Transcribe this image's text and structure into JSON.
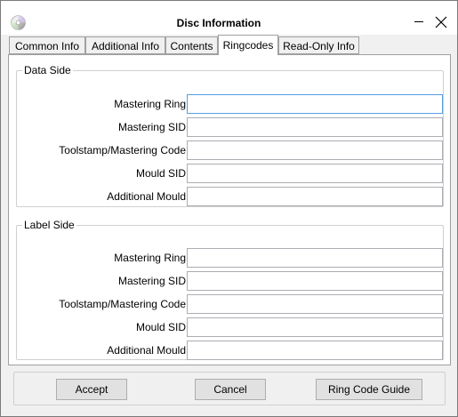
{
  "window": {
    "title": "Disc Information"
  },
  "tabs": [
    {
      "label": "Common Info"
    },
    {
      "label": "Additional Info"
    },
    {
      "label": "Contents"
    },
    {
      "label": "Ringcodes"
    },
    {
      "label": "Read-Only Info"
    }
  ],
  "active_tab": "Ringcodes",
  "data_side": {
    "legend": "Data Side",
    "fields": [
      {
        "label": "Mastering Ring",
        "value": ""
      },
      {
        "label": "Mastering SID",
        "value": ""
      },
      {
        "label": "Toolstamp/Mastering Code",
        "value": ""
      },
      {
        "label": "Mould SID",
        "value": ""
      },
      {
        "label": "Additional Mould",
        "value": ""
      }
    ]
  },
  "label_side": {
    "legend": "Label Side",
    "fields": [
      {
        "label": "Mastering Ring",
        "value": ""
      },
      {
        "label": "Mastering SID",
        "value": ""
      },
      {
        "label": "Toolstamp/Mastering Code",
        "value": ""
      },
      {
        "label": "Mould SID",
        "value": ""
      },
      {
        "label": "Additional Mould",
        "value": ""
      }
    ]
  },
  "buttons": {
    "accept": "Accept",
    "cancel": "Cancel",
    "guide": "Ring Code Guide"
  },
  "icons": {
    "app": "disc-icon",
    "minimize": "minimize-icon",
    "close": "close-icon"
  }
}
